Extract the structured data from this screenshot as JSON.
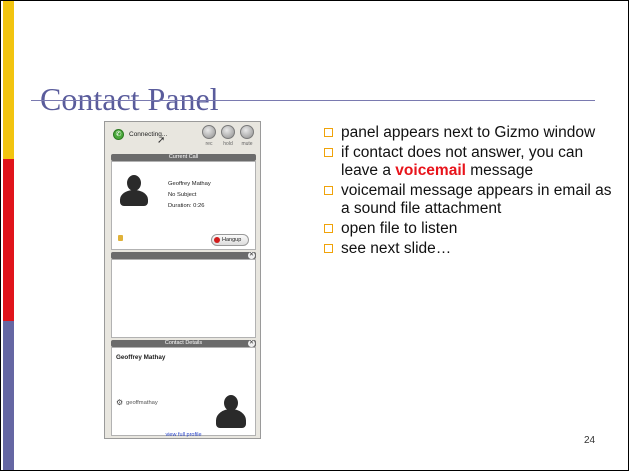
{
  "slide": {
    "title": "Contact Panel",
    "page_number": "24",
    "colors": {
      "accent_bar_yellow": "#f2c40f",
      "accent_bar_red": "#e0141b",
      "accent_bar_blue": "#6567a3",
      "title": "#5a5c9c",
      "highlight": "#e8141b",
      "bullet_border": "#f0a30a"
    }
  },
  "bullets": [
    {
      "text": "panel appears next to Gizmo window"
    },
    {
      "pre": "if contact does not answer, you can leave a ",
      "highlight": "voicemail",
      "post": " message"
    },
    {
      "text": "voicemail message appears in email as a sound file attachment"
    },
    {
      "text": "open file to listen"
    },
    {
      "text": "see next slide…"
    }
  ],
  "panel": {
    "status": "Connecting...",
    "buttons": {
      "rec": "rec",
      "hold": "hold",
      "mute": "mute"
    },
    "current_call": {
      "header": "Current Call",
      "name": "Geoffrey Mathay",
      "subject": "No Subject",
      "duration": "Duration: 0:26",
      "hangup_label": "Hangup"
    },
    "contact_details": {
      "header": "Contact Details",
      "name": "Geoffrey Mathay",
      "username": "geoffmathay",
      "link": "view full profile"
    },
    "icons": {
      "status": "phone-connecting-icon",
      "cursor": "mouse-cursor-icon",
      "lock": "lock-icon",
      "gear": "gear-icon",
      "close": "close-icon"
    }
  }
}
